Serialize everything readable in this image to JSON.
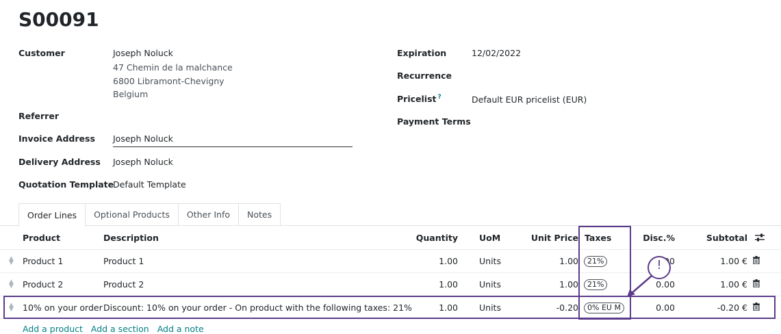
{
  "record": {
    "title": "S00091"
  },
  "left_fields": {
    "customer_label": "Customer",
    "customer_name": "Joseph Noluck",
    "customer_addr1": "47 Chemin de la malchance",
    "customer_addr2": "6800 Libramont-Chevigny",
    "customer_addr3": "Belgium",
    "referrer_label": "Referrer",
    "invoice_label": "Invoice Address",
    "invoice_value": "Joseph Noluck",
    "delivery_label": "Delivery Address",
    "delivery_value": "Joseph Noluck",
    "template_label": "Quotation Template",
    "template_value": "Default Template"
  },
  "right_fields": {
    "expiration_label": "Expiration",
    "expiration_value": "12/02/2022",
    "recurrence_label": "Recurrence",
    "pricelist_label": "Pricelist",
    "pricelist_help": "?",
    "pricelist_value": "Default EUR pricelist (EUR)",
    "payment_terms_label": "Payment Terms"
  },
  "tabs": [
    {
      "label": "Order Lines",
      "active": true
    },
    {
      "label": "Optional Products"
    },
    {
      "label": "Other Info"
    },
    {
      "label": "Notes"
    }
  ],
  "table": {
    "headers": {
      "product": "Product",
      "description": "Description",
      "quantity": "Quantity",
      "uom": "UoM",
      "unit_price": "Unit Price",
      "taxes": "Taxes",
      "disc": "Disc.%",
      "subtotal": "Subtotal"
    },
    "rows": [
      {
        "product": "Product 1",
        "description": "Product 1",
        "quantity": "1.00",
        "uom": "Units",
        "unit_price": "1.00",
        "tax": "21%",
        "disc": "0.00",
        "subtotal": "1.00 €"
      },
      {
        "product": "Product 2",
        "description": "Product 2",
        "quantity": "1.00",
        "uom": "Units",
        "unit_price": "1.00",
        "tax": "21%",
        "disc": "0.00",
        "subtotal": "1.00 €"
      },
      {
        "product": "10% on your order",
        "description": "Discount: 10% on your order - On product with the following taxes: 21%",
        "quantity": "1.00",
        "uom": "Units",
        "unit_price": "-0.20",
        "tax": "0% EU M",
        "disc": "0.00",
        "subtotal": "-0.20 €"
      }
    ]
  },
  "callout": {
    "symbol": "!"
  },
  "add_links": [
    "Add a product",
    "Add a section",
    "Add a note"
  ],
  "colors": {
    "accent": "#017e84",
    "annotation": "#5b3a8a"
  }
}
